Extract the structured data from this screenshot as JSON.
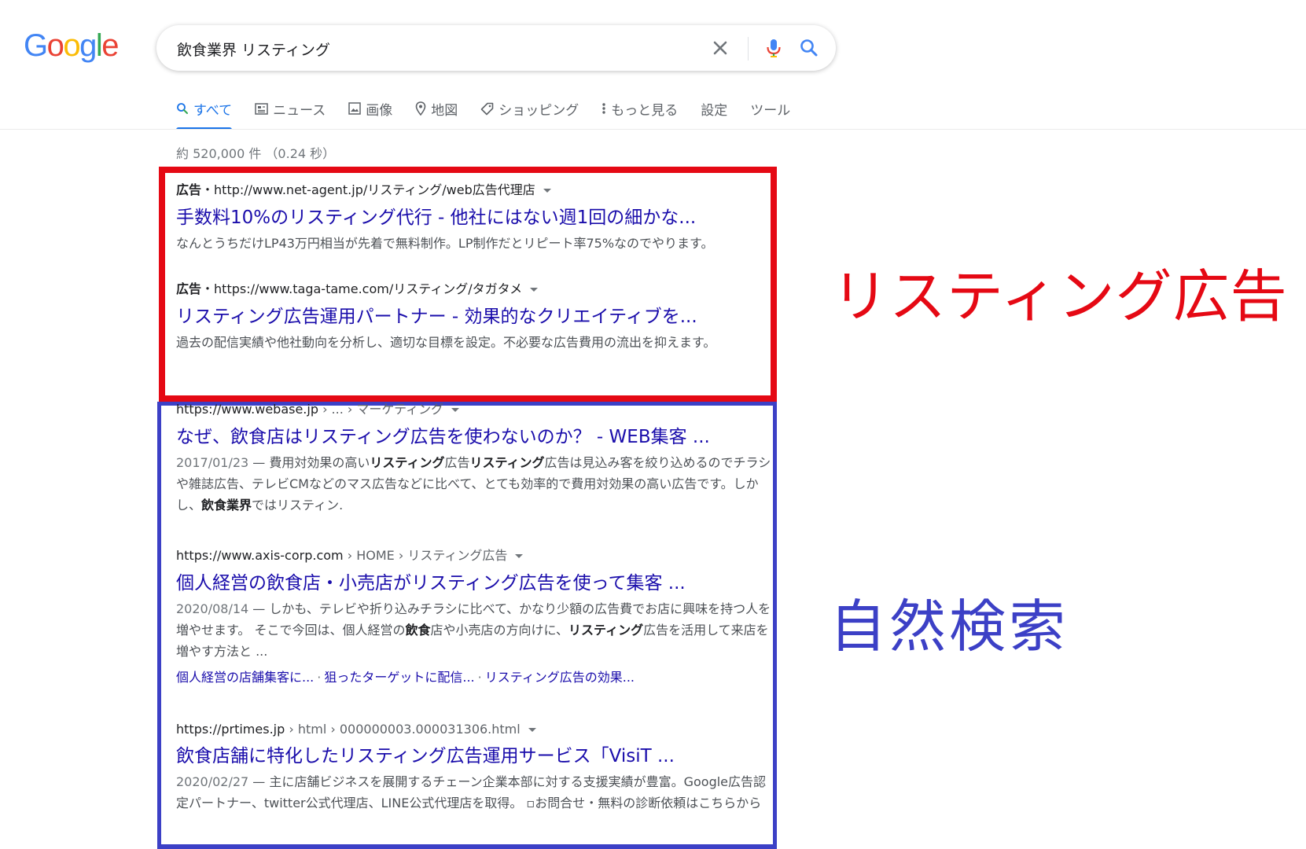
{
  "logo": {
    "letters": [
      "G",
      "o",
      "o",
      "g",
      "l",
      "e"
    ],
    "colors": [
      "#4285F4",
      "#EA4335",
      "#FBBC05",
      "#4285F4",
      "#34A853",
      "#EA4335"
    ]
  },
  "search": {
    "query": "飲食業界 リスティング"
  },
  "icons": {
    "clear": "close-icon",
    "voice": "microphone-icon",
    "search": "search-icon"
  },
  "tabs": [
    {
      "label": "すべて",
      "icon": "search-icon",
      "active": true
    },
    {
      "label": "ニュース",
      "icon": "news-icon"
    },
    {
      "label": "画像",
      "icon": "image-icon"
    },
    {
      "label": "地図",
      "icon": "map-pin-icon"
    },
    {
      "label": "ショッピング",
      "icon": "tag-icon"
    },
    {
      "label": "もっと見る",
      "icon": "more-vert-icon"
    },
    {
      "label": "設定"
    },
    {
      "label": "ツール"
    }
  ],
  "result_stats": "約 520,000 件 （0.24 秒）",
  "ads": [
    {
      "ad_label": "広告",
      "url": "http://www.net-agent.jp/リスティング/web広告代理店",
      "title": "手数料10%のリスティング代行 - 他社にはない週1回の細かな...",
      "snippet": "なんとうちだけLP43万円相当が先着で無料制作。LP制作だとリピート率75%なのでやります。"
    },
    {
      "ad_label": "広告",
      "url": "https://www.taga-tame.com/リスティング/タガタメ",
      "title": "リスティング広告運用パートナー - 効果的なクリエイティブを...",
      "snippet": "過去の配信実績や他社動向を分析し、適切な目標を設定。不必要な広告費用の流出を抑えます。"
    }
  ],
  "organic": [
    {
      "domain": "https://www.webase.jp",
      "breadcrumb": " › ... › マーケティング",
      "title": "なぜ、飲食店はリスティング広告を使わないのか？ - WEB集客 ...",
      "date": "2017/01/23",
      "snippet_parts": [
        {
          "t": "費用対効果の高い"
        },
        {
          "t": "リスティング",
          "b": true
        },
        {
          "t": "広告"
        },
        {
          "t": "リスティング",
          "b": true
        },
        {
          "t": "広告は見込み客を絞り込めるのでチラシや雑誌広告、テレビCMなどのマス広告などに比べて、とても効率的で費用対効果の高い広告です。しかし、"
        },
        {
          "t": "飲食業界",
          "b": true
        },
        {
          "t": "ではリスティン."
        }
      ]
    },
    {
      "domain": "https://www.axis-corp.com",
      "breadcrumb": " › HOME › リスティング広告",
      "title": "個人経営の飲食店・小売店がリスティング広告を使って集客 ...",
      "date": "2020/08/14",
      "snippet_parts": [
        {
          "t": "しかも、テレビや折り込みチラシに比べて、かなり少額の広告費でお店に興味を持つ人を増やせます。 そこで今回は、個人経営の"
        },
        {
          "t": "飲食",
          "b": true
        },
        {
          "t": "店や小売店の方向けに、"
        },
        {
          "t": "リスティング",
          "b": true
        },
        {
          "t": "広告を活用して来店を増やす方法と ..."
        }
      ],
      "sitelinks": [
        "個人経営の店舗集客に...",
        "狙ったターゲットに配信...",
        "リスティング広告の効果..."
      ]
    },
    {
      "domain": "https://prtimes.jp",
      "breadcrumb": " › html › 000000003.000031306.html",
      "title": "飲食店舗に特化したリスティング広告運用サービス「VisiT ...",
      "date": "2020/02/27",
      "snippet_parts": [
        {
          "t": "主に店舗ビジネスを展開するチェーン企業本部に対する支援実績が豊富。Google広告認定パートナー、twitter公式代理店、LINE公式代理店を取得。 ▫お問合せ・無料の診断依頼はこちらから"
        }
      ]
    }
  ],
  "annotations": {
    "ads_label": "リスティング広告",
    "ads_color": "#e50914",
    "organic_label": "自然検索",
    "organic_color": "#3c40c6"
  },
  "colors": {
    "link": "#1a0dab",
    "tab_active": "#1a73e8"
  }
}
